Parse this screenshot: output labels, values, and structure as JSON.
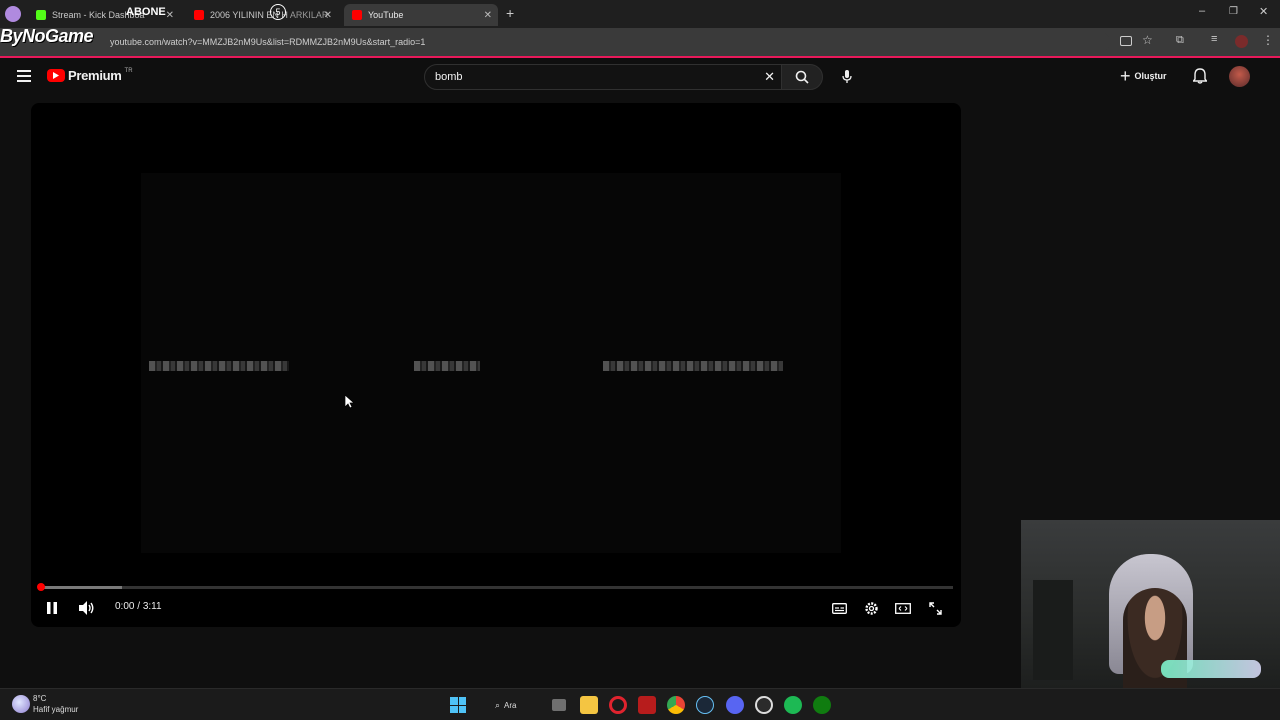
{
  "tabs": [
    {
      "title": "Stream - Kick Dashboa",
      "favicon_color": "#53fc18"
    },
    {
      "title": "2006 YILININ EN H",
      "title_tail": "ARKILAR",
      "favicon_color": "#ff0000"
    },
    {
      "title": "YouTube",
      "favicon_color": "#ff0000",
      "active": true
    }
  ],
  "overlay": {
    "brand": "ByNoGame",
    "abone": "ABONE",
    "badge": "5"
  },
  "address": {
    "url": "youtube.com/watch?v=MMZJB2nM9Us&list=RDMMZJB2nM9Us&start_radio=1"
  },
  "youtube": {
    "logo_text": "Premium",
    "logo_region": "TR",
    "search": {
      "value": "bomb"
    },
    "create_label": "Oluştur"
  },
  "player": {
    "time_current": "0:00",
    "time_separator": " / ",
    "time_total": "3:11",
    "progress_played_fraction": 0.003,
    "progress_buffered_fraction": 0.09
  },
  "taskbar": {
    "weather_temp": "8°C",
    "weather_desc": "Hafif yağmur",
    "search_label": "Ara"
  },
  "colors": {
    "accent": "#ff0000",
    "brand_line": "#e8195a"
  }
}
